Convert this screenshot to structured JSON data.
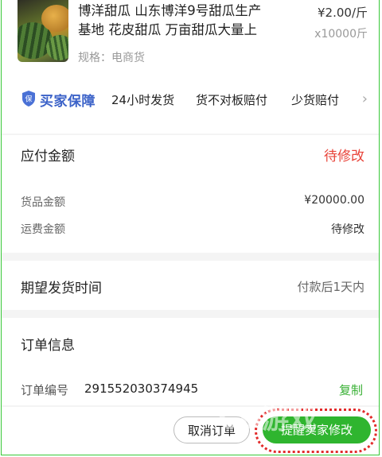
{
  "product": {
    "title_line1": "博洋甜瓜 山东博洋9号甜瓜生产",
    "title_line2": "基地 花皮甜瓜 万亩甜瓜大量上",
    "price": "¥2.00/斤",
    "quantity": "x10000斤",
    "spec": "规格：电商货"
  },
  "guarantee": {
    "brand": "买家保障",
    "items": [
      "24小时发货",
      "货不对板赔付",
      "少货赔付"
    ]
  },
  "payment": {
    "title": "应付金额",
    "status": "待修改",
    "goods_label": "货品金额",
    "goods_value": "¥20000.00",
    "freight_label": "运费金额",
    "freight_value": "待修改"
  },
  "shipping": {
    "label": "期望发货时间",
    "value": "付款后1天内"
  },
  "order": {
    "title": "订单信息",
    "number_label": "订单编号",
    "number": "291552030374945",
    "copy": "复制"
  },
  "actions": {
    "cancel": "取消订单",
    "remind": "提醒卖家修改"
  },
  "watermark": "CD游戏",
  "colors": {
    "accent_green": "#2fb52f",
    "alert_red": "#e8443a",
    "brand_blue": "#3b62c8"
  }
}
